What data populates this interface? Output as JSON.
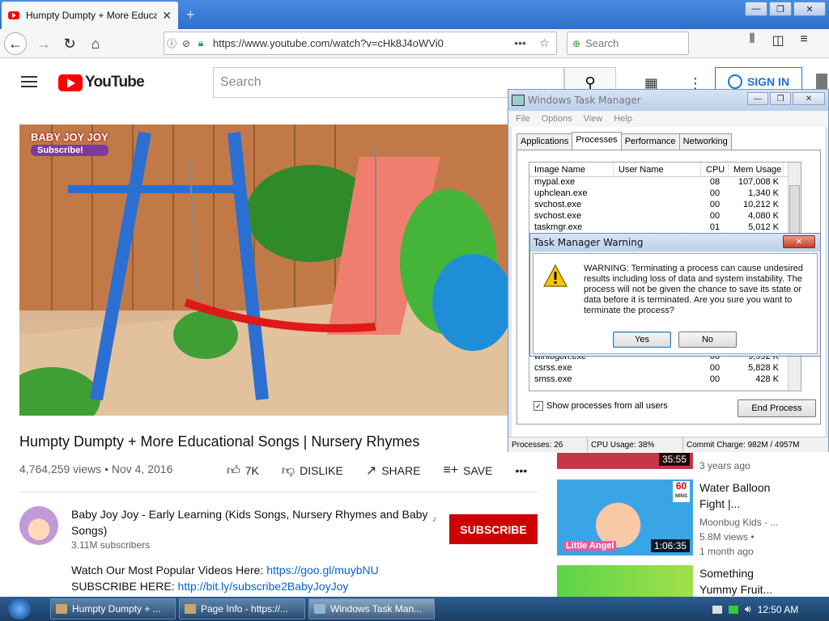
{
  "browser": {
    "tab_title": "Humpty Dumpty + More Educatio",
    "tab_close": "✕",
    "new_tab": "+",
    "url": "https://www.youtube.com/watch?v=cHk8J4oWVi0",
    "search_placeholder": "Search"
  },
  "youtube": {
    "logo_text": "YouTube",
    "search_placeholder": "Search",
    "sign_in": "SIGN IN",
    "video_brand": "BABY JOY JOY",
    "video_brand_sub": "Subscribe!",
    "title": "Humpty Dumpty + More Educational Songs | Nursery Rhymes",
    "views_date": "4,764,259 views • Nov 4, 2016",
    "likes": "7K",
    "dislike": "DISLIKE",
    "share": "SHARE",
    "save": "SAVE",
    "channel_name": "Baby Joy Joy - Early Learning (Kids Songs, Nursery Rhymes and Baby Songs)",
    "subscribers": "3.11M subscribers",
    "subscribe": "SUBSCRIBE",
    "desc1_text": "Watch Our Most Popular Videos Here: ",
    "desc1_link": "https://goo.gl/muybNU",
    "desc2_text": "SUBSCRIBE HERE: ",
    "desc2_link": "http://bit.ly/subscribe2BabyJoyJoy"
  },
  "sidebar": {
    "items": [
      {
        "duration": "35:55",
        "age": "3 years ago"
      },
      {
        "duration": "1:06:35",
        "title_line1": "Water Balloon",
        "title_line2": "Fight |...",
        "channel": "Moonbug Kids - ...",
        "views": "5.8M views •",
        "age": "1 month ago",
        "badge": "60",
        "badge_sub": "MINS",
        "overlay_text": "Little Angel"
      },
      {
        "title_line1": "Something",
        "title_line2": "Yummy Fruit..."
      }
    ]
  },
  "task_manager": {
    "title": "Windows Task Manager",
    "menu": [
      "File",
      "Options",
      "View",
      "Help"
    ],
    "tabs": [
      "Applications",
      "Processes",
      "Performance",
      "Networking"
    ],
    "columns": [
      "Image Name",
      "User Name",
      "CPU",
      "Mem Usage"
    ],
    "rows_top": [
      {
        "name": "mypal.exe",
        "user": "",
        "cpu": "08",
        "mem": "107,008 K"
      },
      {
        "name": "uphclean.exe",
        "user": "",
        "cpu": "00",
        "mem": "1,340 K"
      },
      {
        "name": "svchost.exe",
        "user": "",
        "cpu": "00",
        "mem": "10,212 K"
      },
      {
        "name": "svchost.exe",
        "user": "",
        "cpu": "00",
        "mem": "4,080 K"
      },
      {
        "name": "taskmgr.exe",
        "user": "",
        "cpu": "01",
        "mem": "5,012 K"
      }
    ],
    "rows_bottom": [
      {
        "name": "winlogon.exe",
        "user": "",
        "cpu": "00",
        "mem": "9,992 K"
      },
      {
        "name": "csrss.exe",
        "user": "",
        "cpu": "00",
        "mem": "5,828 K"
      },
      {
        "name": "smss.exe",
        "user": "",
        "cpu": "00",
        "mem": "428 K"
      }
    ],
    "show_all": "Show processes from all users",
    "end_process": "End Process",
    "status_processes": "Processes: 26",
    "status_cpu": "CPU Usage: 38%",
    "status_commit": "Commit Charge: 982M / 4957M"
  },
  "warning": {
    "title": "Task Manager Warning",
    "message": "WARNING: Terminating a process can cause undesired results including loss of data and system instability. The process will not be given the chance to save its state or data before it is terminated.  Are you sure you want to terminate the process?",
    "yes": "Yes",
    "no": "No"
  },
  "taskbar": {
    "items": [
      "Humpty Dumpty + ...",
      "Page Info - https://...",
      "Windows Task Man..."
    ],
    "clock": "12:50 AM"
  }
}
